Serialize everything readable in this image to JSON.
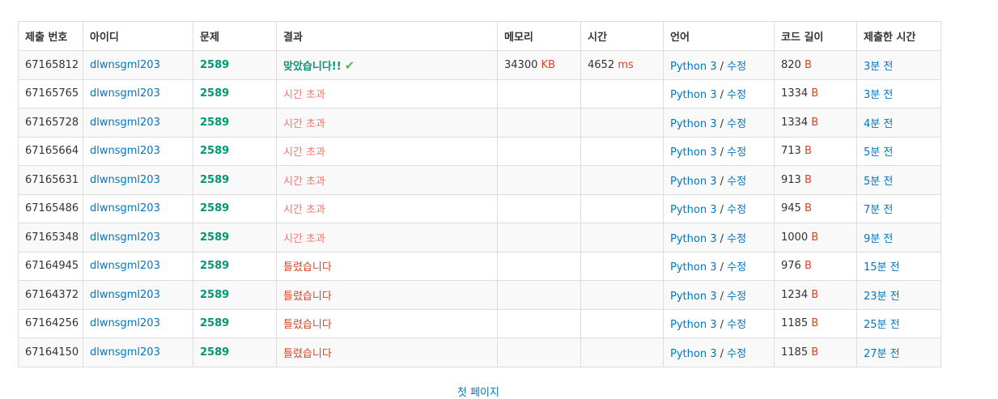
{
  "headers": [
    "제출 번호",
    "아이디",
    "문제",
    "결과",
    "메모리",
    "시간",
    "언어",
    "코드 길이",
    "제출한 시간"
  ],
  "rows": [
    {
      "id": "67165812",
      "user": "dlwnsgml203",
      "problem": "2589",
      "result": "맞았습니다!!",
      "result_type": "ac",
      "memory": "34300",
      "memory_unit": "KB",
      "time": "4652",
      "time_unit": "ms",
      "lang": "Python 3",
      "edit": "수정",
      "code_len": "820",
      "code_unit": "B",
      "submitted": "3분 전"
    },
    {
      "id": "67165765",
      "user": "dlwnsgml203",
      "problem": "2589",
      "result": "시간 초과",
      "result_type": "tle",
      "memory": "",
      "memory_unit": "",
      "time": "",
      "time_unit": "",
      "lang": "Python 3",
      "edit": "수정",
      "code_len": "1334",
      "code_unit": "B",
      "submitted": "3분 전"
    },
    {
      "id": "67165728",
      "user": "dlwnsgml203",
      "problem": "2589",
      "result": "시간 초과",
      "result_type": "tle",
      "memory": "",
      "memory_unit": "",
      "time": "",
      "time_unit": "",
      "lang": "Python 3",
      "edit": "수정",
      "code_len": "1334",
      "code_unit": "B",
      "submitted": "4분 전"
    },
    {
      "id": "67165664",
      "user": "dlwnsgml203",
      "problem": "2589",
      "result": "시간 초과",
      "result_type": "tle",
      "memory": "",
      "memory_unit": "",
      "time": "",
      "time_unit": "",
      "lang": "Python 3",
      "edit": "수정",
      "code_len": "713",
      "code_unit": "B",
      "submitted": "5분 전"
    },
    {
      "id": "67165631",
      "user": "dlwnsgml203",
      "problem": "2589",
      "result": "시간 초과",
      "result_type": "tle",
      "memory": "",
      "memory_unit": "",
      "time": "",
      "time_unit": "",
      "lang": "Python 3",
      "edit": "수정",
      "code_len": "913",
      "code_unit": "B",
      "submitted": "5분 전"
    },
    {
      "id": "67165486",
      "user": "dlwnsgml203",
      "problem": "2589",
      "result": "시간 초과",
      "result_type": "tle",
      "memory": "",
      "memory_unit": "",
      "time": "",
      "time_unit": "",
      "lang": "Python 3",
      "edit": "수정",
      "code_len": "945",
      "code_unit": "B",
      "submitted": "7분 전"
    },
    {
      "id": "67165348",
      "user": "dlwnsgml203",
      "problem": "2589",
      "result": "시간 초과",
      "result_type": "tle",
      "memory": "",
      "memory_unit": "",
      "time": "",
      "time_unit": "",
      "lang": "Python 3",
      "edit": "수정",
      "code_len": "1000",
      "code_unit": "B",
      "submitted": "9분 전"
    },
    {
      "id": "67164945",
      "user": "dlwnsgml203",
      "problem": "2589",
      "result": "틀렸습니다",
      "result_type": "wa",
      "memory": "",
      "memory_unit": "",
      "time": "",
      "time_unit": "",
      "lang": "Python 3",
      "edit": "수정",
      "code_len": "976",
      "code_unit": "B",
      "submitted": "15분 전"
    },
    {
      "id": "67164372",
      "user": "dlwnsgml203",
      "problem": "2589",
      "result": "틀렸습니다",
      "result_type": "wa",
      "memory": "",
      "memory_unit": "",
      "time": "",
      "time_unit": "",
      "lang": "Python 3",
      "edit": "수정",
      "code_len": "1234",
      "code_unit": "B",
      "submitted": "23분 전"
    },
    {
      "id": "67164256",
      "user": "dlwnsgml203",
      "problem": "2589",
      "result": "틀렸습니다",
      "result_type": "wa",
      "memory": "",
      "memory_unit": "",
      "time": "",
      "time_unit": "",
      "lang": "Python 3",
      "edit": "수정",
      "code_len": "1185",
      "code_unit": "B",
      "submitted": "25분 전"
    },
    {
      "id": "67164150",
      "user": "dlwnsgml203",
      "problem": "2589",
      "result": "틀렸습니다",
      "result_type": "wa",
      "memory": "",
      "memory_unit": "",
      "time": "",
      "time_unit": "",
      "lang": "Python 3",
      "edit": "수정",
      "code_len": "1185",
      "code_unit": "B",
      "submitted": "27분 전"
    }
  ],
  "ac_icon": "check-icon",
  "colors": {
    "link": "#0076c0",
    "accepted": "#009874",
    "tle": "#fa7268",
    "wrong": "#dd4124",
    "unit": "#dd4124",
    "check": "#5cb85c"
  },
  "pagination": {
    "first_page_label": "첫 페이지"
  }
}
